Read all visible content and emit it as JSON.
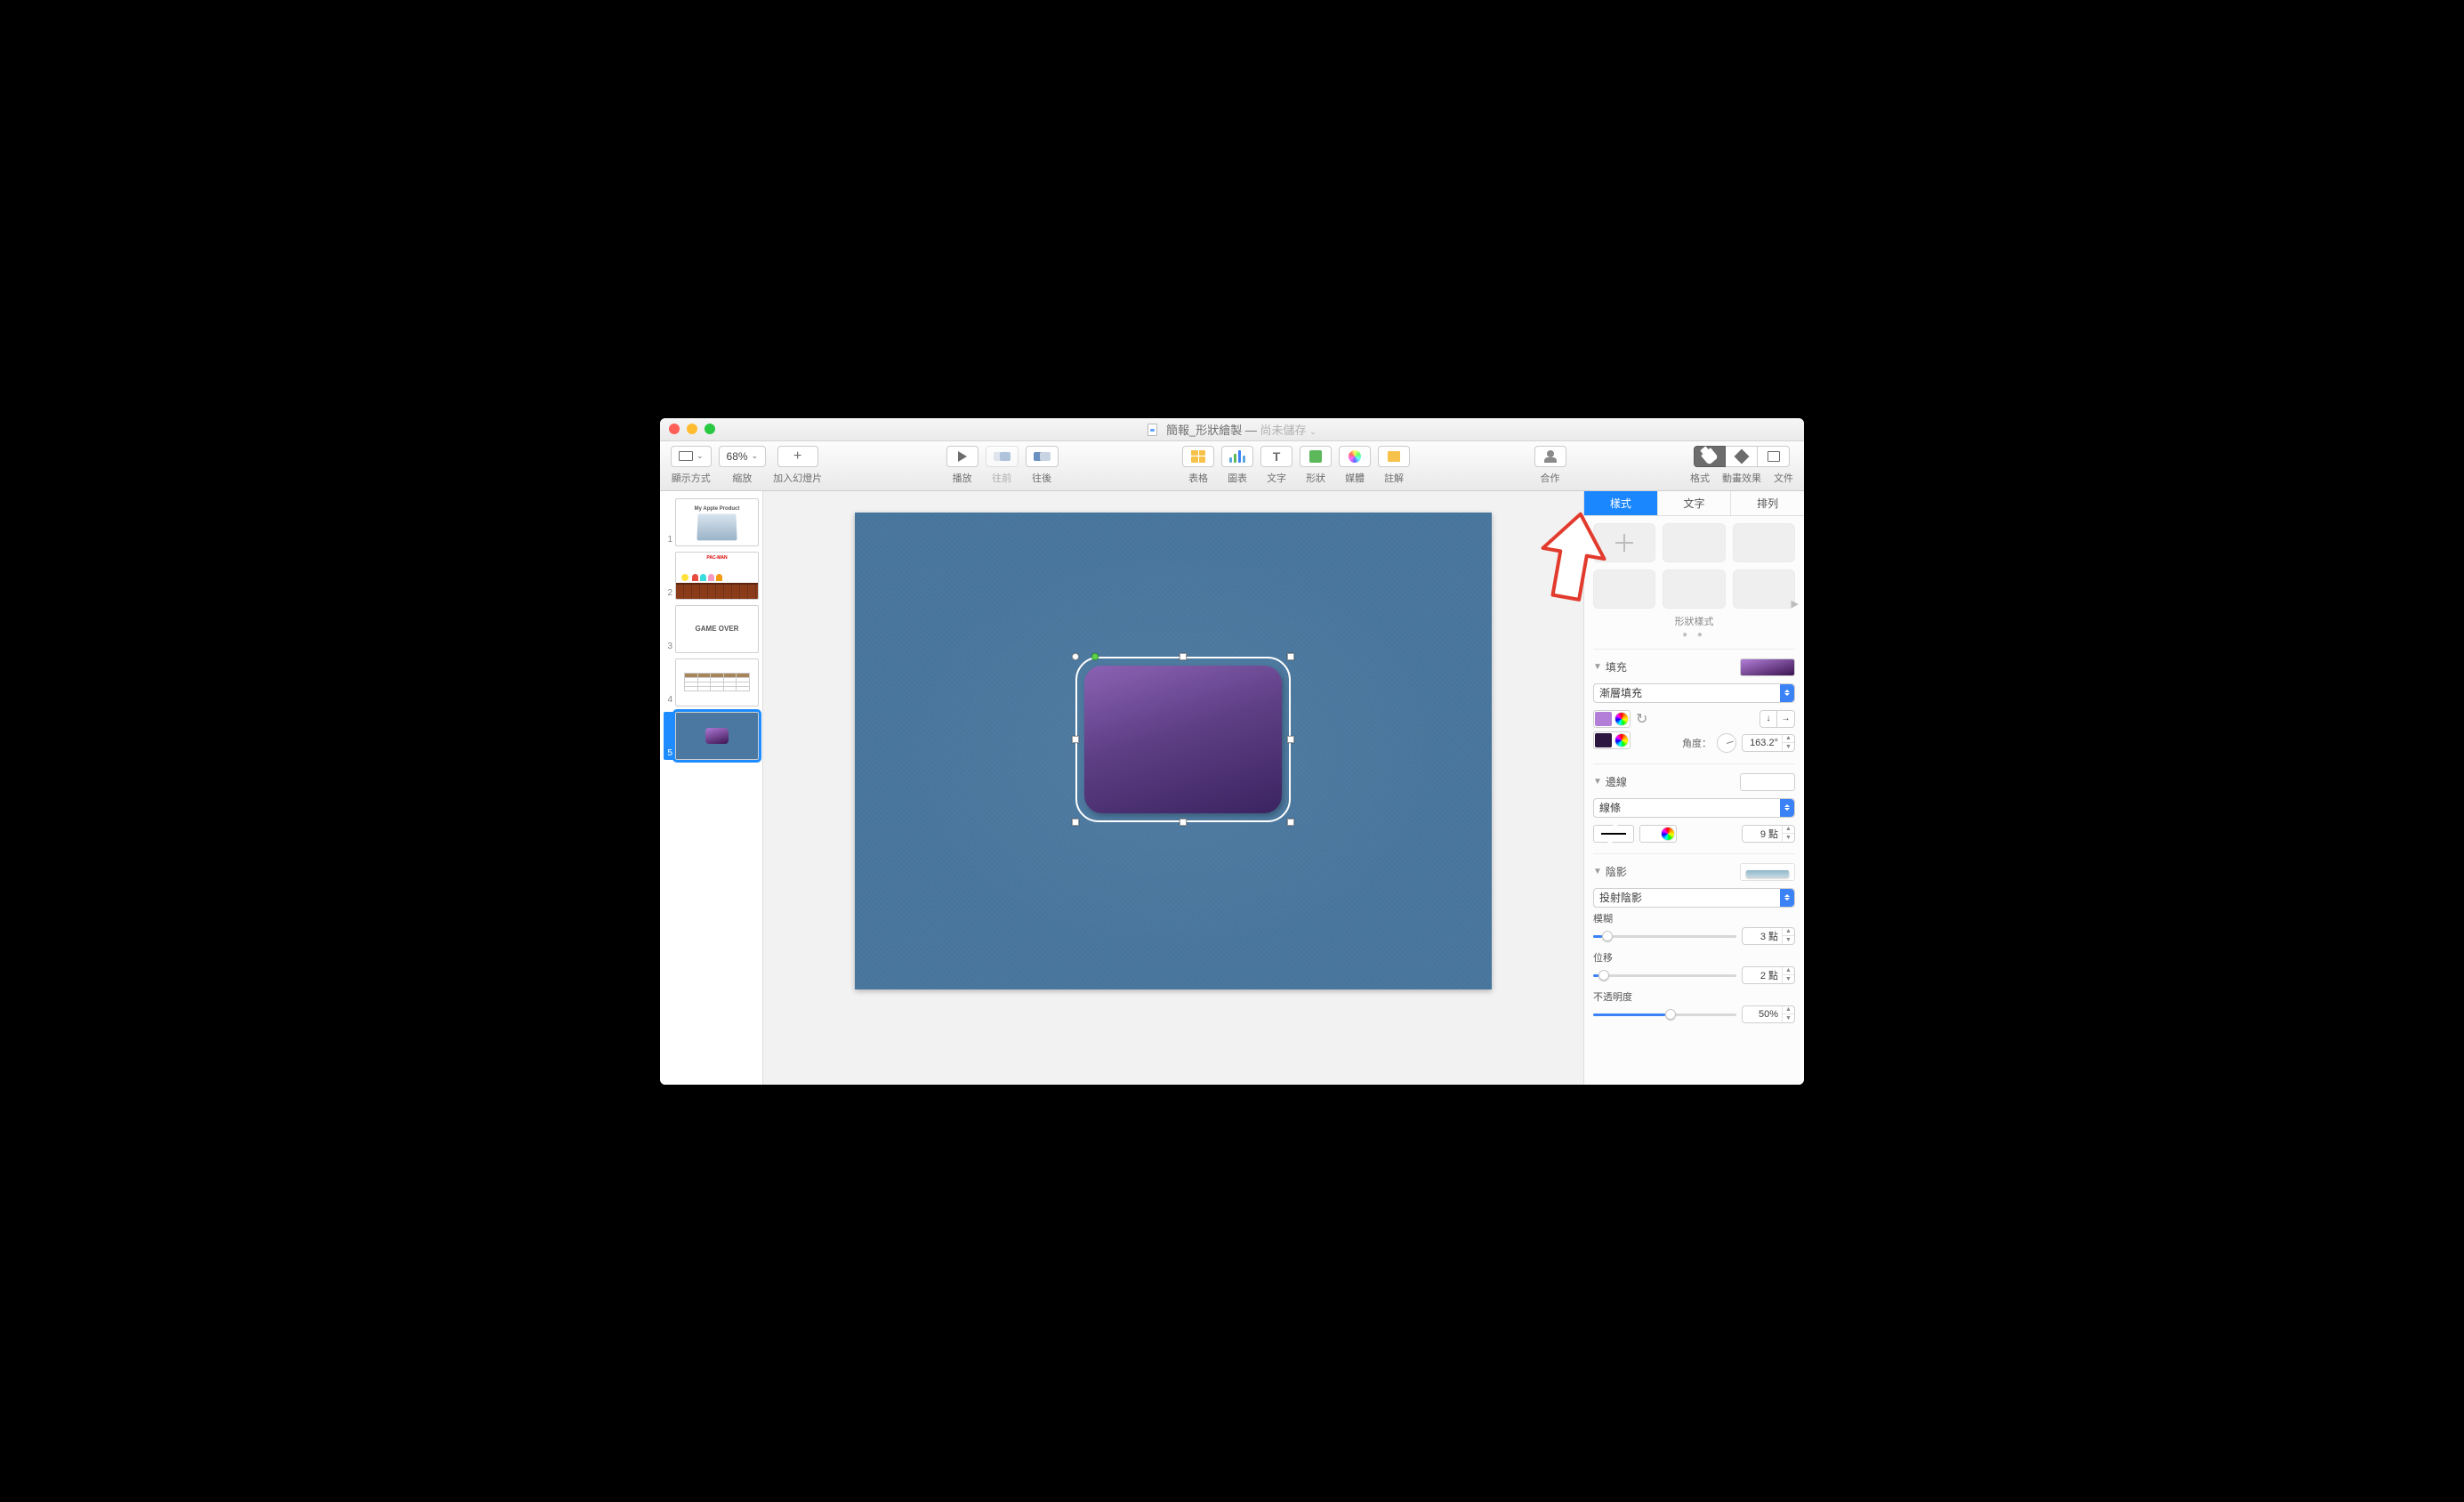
{
  "window": {
    "doc_title": "簡報_形狀繪製",
    "separator": " — ",
    "saved_status": "尚未儲存"
  },
  "toolbar": {
    "view": "顯示方式",
    "zoom_value": "68%",
    "zoom": "縮放",
    "add_slide": "加入幻燈片",
    "play": "播放",
    "prev": "往前",
    "next": "往後",
    "table": "表格",
    "chart": "圖表",
    "text": "文字",
    "shape": "形狀",
    "media": "媒體",
    "note": "註解",
    "collab": "合作",
    "format": "格式",
    "anim": "動畫效果",
    "doc": "文件"
  },
  "slides": {
    "items": [
      {
        "num": "1",
        "title": "My Apple Product"
      },
      {
        "num": "2",
        "title": "PAC-MAN"
      },
      {
        "num": "3",
        "title": "GAME OVER"
      },
      {
        "num": "4",
        "title": ""
      },
      {
        "num": "5",
        "title": ""
      }
    ]
  },
  "inspector": {
    "tabs": {
      "style": "樣式",
      "text": "文字",
      "arrange": "排列"
    },
    "shape_styles_label": "形狀樣式",
    "fill": {
      "label": "填充",
      "type": "漸層填充",
      "angle_label": "角度：",
      "angle_value": "163.2°"
    },
    "border": {
      "label": "邊線",
      "type": "線條",
      "width_value": "9 點"
    },
    "shadow": {
      "label": "陰影",
      "type": "投射陰影",
      "blur_label": "模糊",
      "blur_value": "3 點",
      "offset_label": "位移",
      "offset_value": "2 點",
      "opacity_label": "不透明度",
      "opacity_value": "50%"
    }
  }
}
